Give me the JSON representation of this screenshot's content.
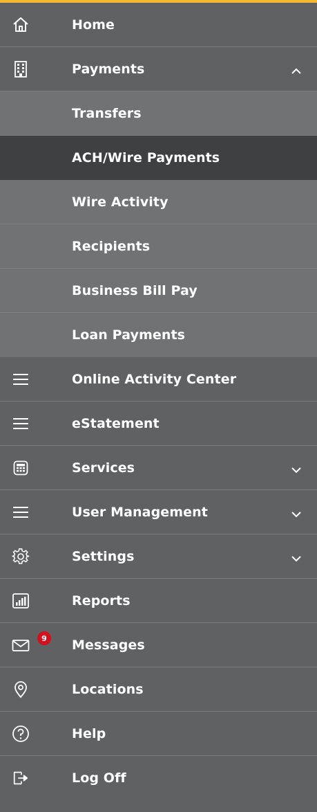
{
  "menu": {
    "home": {
      "label": "Home",
      "icon": "home-icon"
    },
    "payments": {
      "label": "Payments",
      "icon": "building-icon",
      "expanded": true
    },
    "payments_sub": [
      {
        "label": "Transfers",
        "active": false
      },
      {
        "label": "ACH/Wire Payments",
        "active": true
      },
      {
        "label": "Wire Activity",
        "active": false
      },
      {
        "label": "Recipients",
        "active": false
      },
      {
        "label": "Business Bill Pay",
        "active": false
      },
      {
        "label": "Loan Payments",
        "active": false
      }
    ],
    "online_activity": {
      "label": "Online Activity Center",
      "icon": "menu-icon"
    },
    "estatement": {
      "label": "eStatement",
      "icon": "menu-icon"
    },
    "services": {
      "label": "Services",
      "icon": "calculator-icon"
    },
    "user_management": {
      "label": "User Management",
      "icon": "menu-icon"
    },
    "settings": {
      "label": "Settings",
      "icon": "gear-icon"
    },
    "reports": {
      "label": "Reports",
      "icon": "bar-chart-icon"
    },
    "messages": {
      "label": "Messages",
      "icon": "envelope-icon",
      "badge": "9"
    },
    "locations": {
      "label": "Locations",
      "icon": "location-pin-icon"
    },
    "help": {
      "label": "Help",
      "icon": "help-icon"
    },
    "logoff": {
      "label": "Log Off",
      "icon": "logout-icon"
    }
  },
  "colors": {
    "accent": "#f4b92f",
    "background": "#606163",
    "submenu": "#707274",
    "active": "#3f4042",
    "badge": "#d0111f"
  }
}
